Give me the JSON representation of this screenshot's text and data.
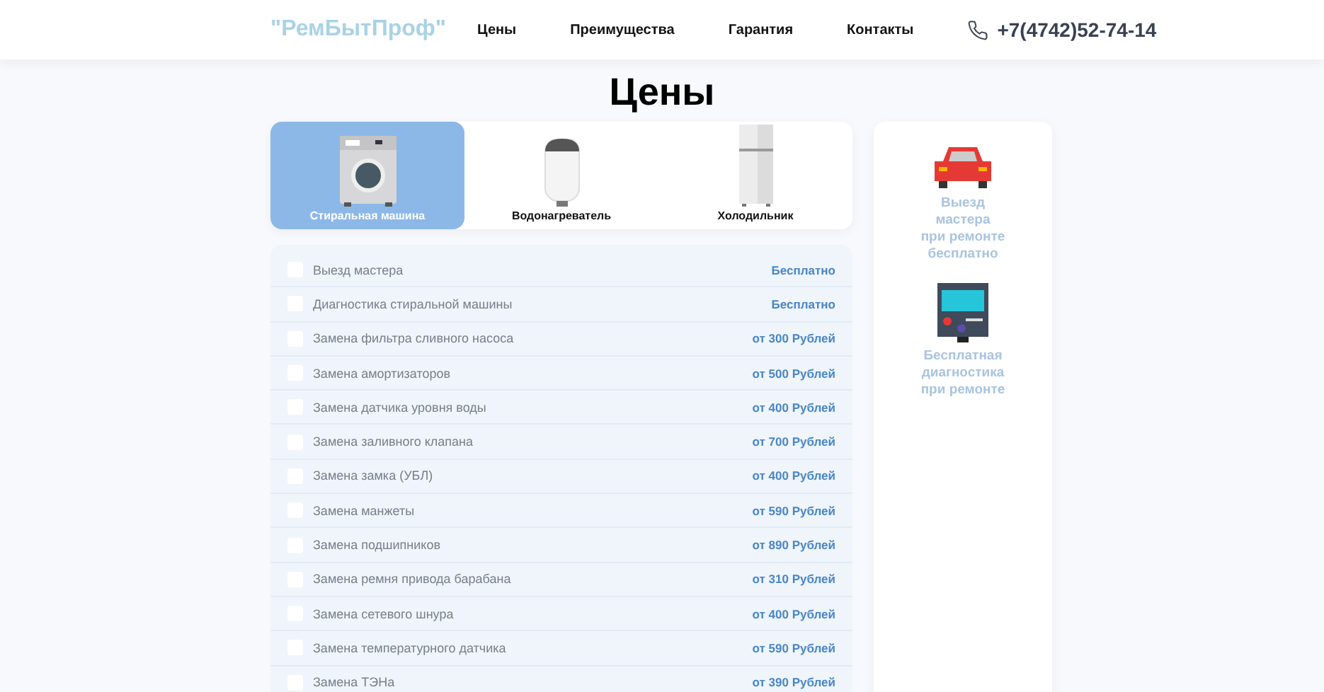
{
  "header": {
    "logo": "\"РемБытПроф\"",
    "nav": [
      "Цены",
      "Преимущества",
      "Гарантия",
      "Контакты"
    ],
    "phone": "+7(4742)52-74-14"
  },
  "title": "Цены",
  "tabs": [
    {
      "label": "Стиральная машина",
      "kind": "washer",
      "selected": true
    },
    {
      "label": "Водонагреватель",
      "kind": "boiler",
      "selected": false
    },
    {
      "label": "Холодильник",
      "kind": "fridge",
      "selected": false
    }
  ],
  "prices": [
    {
      "name": "Выезд мастера",
      "price": "Бесплатно",
      "checked": false
    },
    {
      "name": "Диагностика стиральной машины",
      "price": "Бесплатно",
      "checked": false
    },
    {
      "name": "Замена фильтра сливного насоса",
      "price": "от 300 Рублей",
      "checked": false
    },
    {
      "name": "Замена амортизаторов",
      "price": "от 500 Рублей",
      "checked": false
    },
    {
      "name": "Замена датчика уровня воды",
      "price": "от 400 Рублей",
      "checked": false
    },
    {
      "name": "Замена заливного клапана",
      "price": "от 700 Рублей",
      "checked": false
    },
    {
      "name": "Замена замка (УБЛ)",
      "price": "от 400 Рублей",
      "checked": false
    },
    {
      "name": "Замена манжеты",
      "price": "от 590 Рублей",
      "checked": false
    },
    {
      "name": "Замена подшипников",
      "price": "от 890 Рублей",
      "checked": false
    },
    {
      "name": "Замена ремня привода барабана",
      "price": "от 310 Рублей",
      "checked": false
    },
    {
      "name": "Замена сетевого шнура",
      "price": "от 400 Рублей",
      "checked": false
    },
    {
      "name": "Замена температурного датчика",
      "price": "от 590 Рублей",
      "checked": false
    },
    {
      "name": "Замена ТЭНа",
      "price": "от 390 Рублей",
      "checked": false
    }
  ],
  "benefits": [
    {
      "kind": "car",
      "lines": [
        "Выезд",
        "мастера",
        "при ремонте",
        "бесплатно"
      ]
    },
    {
      "kind": "diagnostic",
      "lines": [
        "Бесплатная",
        "диагностика",
        "при ремонте"
      ]
    }
  ]
}
